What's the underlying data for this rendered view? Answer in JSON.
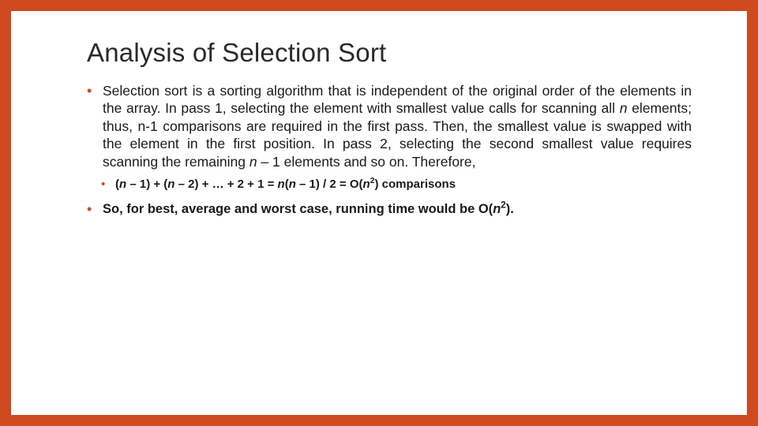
{
  "accent_color": "#d04a1f",
  "slide": {
    "title": "Analysis of Selection Sort",
    "bullet1_pre": "Selection sort is a sorting algorithm that is independent of the original order of the elements in the array. In pass 1, selecting the element with smallest value calls for scanning all ",
    "bullet1_n1": "n",
    "bullet1_mid1": " elements; thus, n-1 comparisons are required in the first pass.  Then, the smallest value is swapped with the element in the first position. In pass 2, selecting the second smallest value requires scanning the remaining ",
    "bullet1_n2": "n",
    "bullet1_post": " – 1 elements and so on. Therefore,",
    "formula_p1": "(",
    "formula_n1": "n",
    "formula_p2": " – 1) + (",
    "formula_n2": "n",
    "formula_p3": " – 2) + … + 2 + 1 = ",
    "formula_n3": "n",
    "formula_p4": "(",
    "formula_n4": "n",
    "formula_p5": " – 1) / 2 = O(",
    "formula_n5": "n",
    "formula_sup1": "2",
    "formula_p6": ") comparisons",
    "concl_pre": "So, for best, average and worst case, running time would be O(",
    "concl_n": "n",
    "concl_sup": "2",
    "concl_post": ")."
  }
}
